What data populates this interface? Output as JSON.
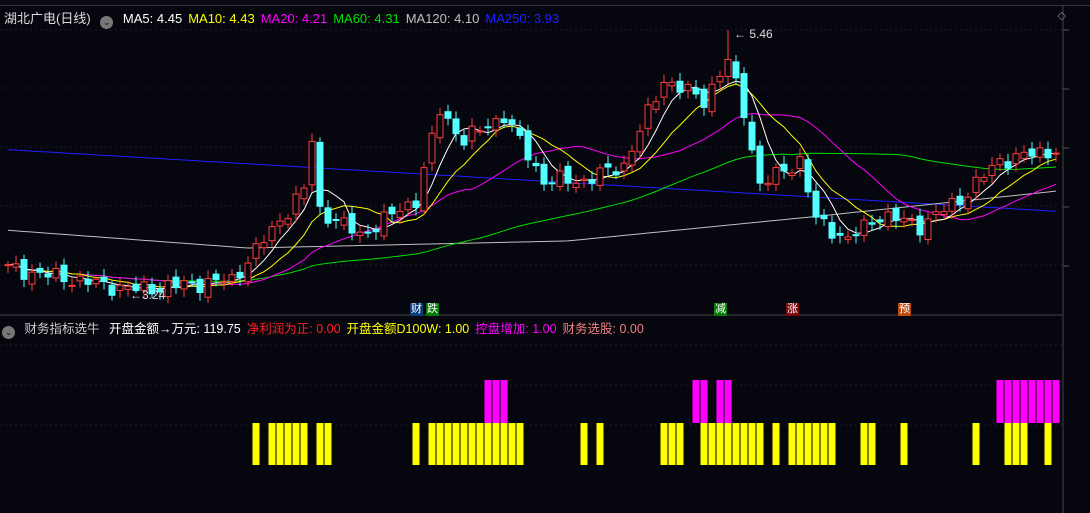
{
  "header": {
    "stock": "湖北广电(日线)",
    "ma": [
      {
        "label": "MA5: 4.45",
        "color": "#ffffff"
      },
      {
        "label": "MA10: 4.43",
        "color": "#ffff00"
      },
      {
        "label": "MA20: 4.21",
        "color": "#ff00ff"
      },
      {
        "label": "MA60: 4.31",
        "color": "#00e000"
      },
      {
        "label": "MA120: 4.10",
        "color": "#c0c0c0"
      },
      {
        "label": "MA250: 3.93",
        "color": "#2020ff"
      }
    ]
  },
  "indicator": {
    "name": "财务指标选牛",
    "items": [
      {
        "label": "开盘金额→万元: 119.75",
        "color": "#ffffff"
      },
      {
        "label": "净利润为正: 0.00",
        "color": "#ff2020"
      },
      {
        "label": "开盘金额D100W: 1.00",
        "color": "#ffff00"
      },
      {
        "label": "控盘增加: 1.00",
        "color": "#ff00ff"
      },
      {
        "label": "财务选股: 0.00",
        "color": "#f08080"
      }
    ]
  },
  "signals": [
    {
      "text": "财",
      "index": 51,
      "color": "#0a3a7a"
    },
    {
      "text": "跌",
      "index": 53,
      "color": "#0a7a0a"
    },
    {
      "text": "减",
      "index": 89,
      "color": "#0a7a0a"
    },
    {
      "text": "涨",
      "index": 98,
      "color": "#7a0a0a"
    },
    {
      "text": "预",
      "index": 112,
      "color": "#c04a10"
    }
  ],
  "chart_data": {
    "type": "candlestick",
    "high_label": "5.46",
    "low_label": "3.24",
    "high_index": 90,
    "low_index": 16,
    "ylim": [
      3.2,
      5.46
    ],
    "close_keypoints": [
      [
        0,
        3.45
      ],
      [
        12,
        3.31
      ],
      [
        16,
        3.27
      ],
      [
        28,
        3.35
      ],
      [
        31,
        3.6
      ],
      [
        37,
        4.11
      ],
      [
        38,
        4.53
      ],
      [
        39,
        3.94
      ],
      [
        44,
        3.73
      ],
      [
        51,
        4.03
      ],
      [
        54,
        4.78
      ],
      [
        57,
        4.53
      ],
      [
        62,
        4.74
      ],
      [
        67,
        4.19
      ],
      [
        72,
        4.19
      ],
      [
        77,
        4.32
      ],
      [
        82,
        5.04
      ],
      [
        87,
        4.87
      ],
      [
        90,
        5.2
      ],
      [
        92,
        4.78
      ],
      [
        94,
        4.15
      ],
      [
        99,
        4.36
      ],
      [
        101,
        3.86
      ],
      [
        105,
        3.69
      ],
      [
        109,
        3.9
      ],
      [
        114,
        3.81
      ],
      [
        119,
        4.03
      ],
      [
        124,
        4.36
      ],
      [
        131,
        4.45
      ]
    ],
    "ma120_keypoints": [
      [
        0,
        3.77
      ],
      [
        30,
        3.62
      ],
      [
        70,
        3.68
      ],
      [
        100,
        3.88
      ],
      [
        131,
        4.1
      ]
    ],
    "ma250_keypoints": [
      [
        0,
        4.45
      ],
      [
        131,
        3.93
      ]
    ],
    "yellow_bars": [
      31,
      33,
      34,
      35,
      36,
      37,
      39,
      40,
      51,
      53,
      54,
      55,
      56,
      57,
      58,
      59,
      60,
      61,
      62,
      63,
      64,
      72,
      74,
      82,
      83,
      84,
      87,
      88,
      89,
      90,
      91,
      92,
      93,
      94,
      96,
      98,
      99,
      100,
      101,
      102,
      103,
      107,
      108,
      112,
      121,
      125,
      126,
      127,
      130
    ],
    "magenta_bars": [
      60,
      61,
      62,
      86,
      87,
      89,
      90,
      124,
      125,
      126,
      127,
      128,
      129,
      130,
      131
    ]
  }
}
